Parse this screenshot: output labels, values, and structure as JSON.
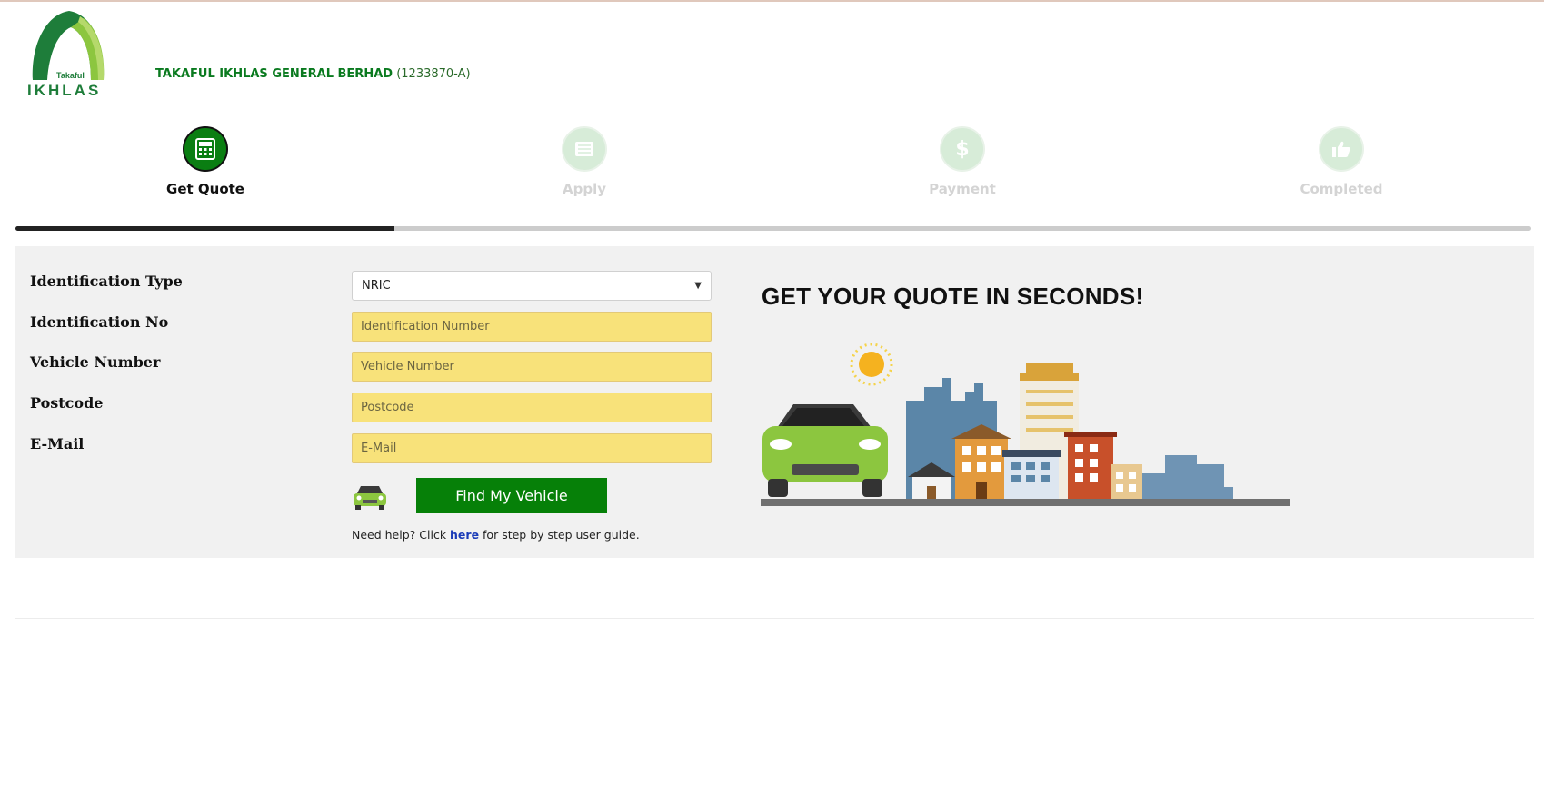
{
  "header": {
    "logo_small": "Takaful",
    "logo_big": "IKHLAS",
    "company_name": "TAKAFUL IKHLAS GENERAL BERHAD",
    "company_reg": "(1233870-A)"
  },
  "steps": [
    {
      "label": "Get Quote",
      "icon": "calculator-icon",
      "active": true
    },
    {
      "label": "Apply",
      "icon": "form-icon",
      "active": false
    },
    {
      "label": "Payment",
      "icon": "dollar-icon",
      "active": false
    },
    {
      "label": "Completed",
      "icon": "thumbs-up-icon",
      "active": false
    }
  ],
  "progress": {
    "fraction": 0.25
  },
  "form": {
    "id_type_label": "Identification Type",
    "id_type_value": "NRIC",
    "id_no_label": "Identification No",
    "id_no_placeholder": "Identification Number",
    "vehicle_label": "Vehicle Number",
    "vehicle_placeholder": "Vehicle Number",
    "postcode_label": "Postcode",
    "postcode_placeholder": "Postcode",
    "email_label": "E-Mail",
    "email_placeholder": "E-Mail",
    "find_button": "Find My Vehicle",
    "help_prefix": "Need help? Click ",
    "help_link": "here",
    "help_suffix": " for step by step user guide."
  },
  "promo": {
    "headline": "GET YOUR QUOTE IN SECONDS!"
  },
  "colors": {
    "brand_green": "#0a7e12",
    "field_yellow": "#f8e27a",
    "link_blue": "#1a3bb8"
  }
}
